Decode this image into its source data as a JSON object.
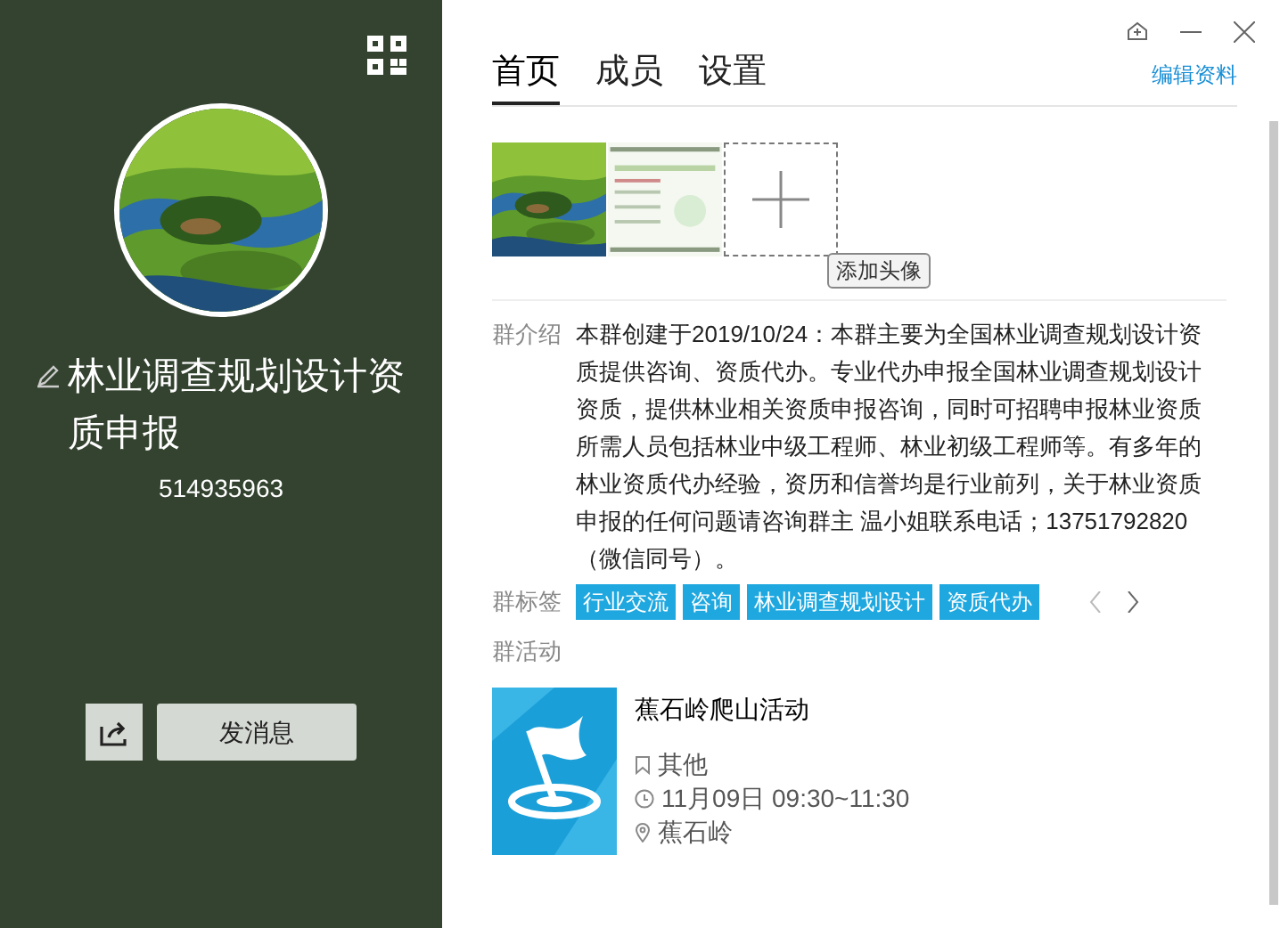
{
  "group": {
    "name": "林业调查规划设计资质申报",
    "id": "514935963"
  },
  "left_buttons": {
    "send": "发消息"
  },
  "tabs": [
    {
      "label": "首页",
      "selected": true
    },
    {
      "label": "成员",
      "selected": false
    },
    {
      "label": "设置",
      "selected": false
    }
  ],
  "edit_link": "编辑资料",
  "add_avatar_tooltip": "添加头像",
  "intro": {
    "label": "群介绍",
    "text": "本群创建于2019/10/24：本群主要为全国林业调查规划设计资质提供咨询、资质代办。专业代办申报全国林业调查规划设计资质，提供林业相关资质申报咨询，同时可招聘申报林业资质所需人员包括林业中级工程师、林业初级工程师等。有多年的林业资质代办经验，资历和信誉均是行业前列，关于林业资质申报的任何问题请咨询群主  温小姐联系电话；13751792820（微信同号）。"
  },
  "tags": {
    "label": "群标签",
    "items": [
      "行业交流",
      "咨询",
      "林业调查规划设计",
      "资质代办"
    ]
  },
  "activity": {
    "label": "群活动",
    "title": "蕉石岭爬山活动",
    "category": "其他",
    "time": "11月09日 09:30~11:30",
    "place": "蕉石岭"
  }
}
